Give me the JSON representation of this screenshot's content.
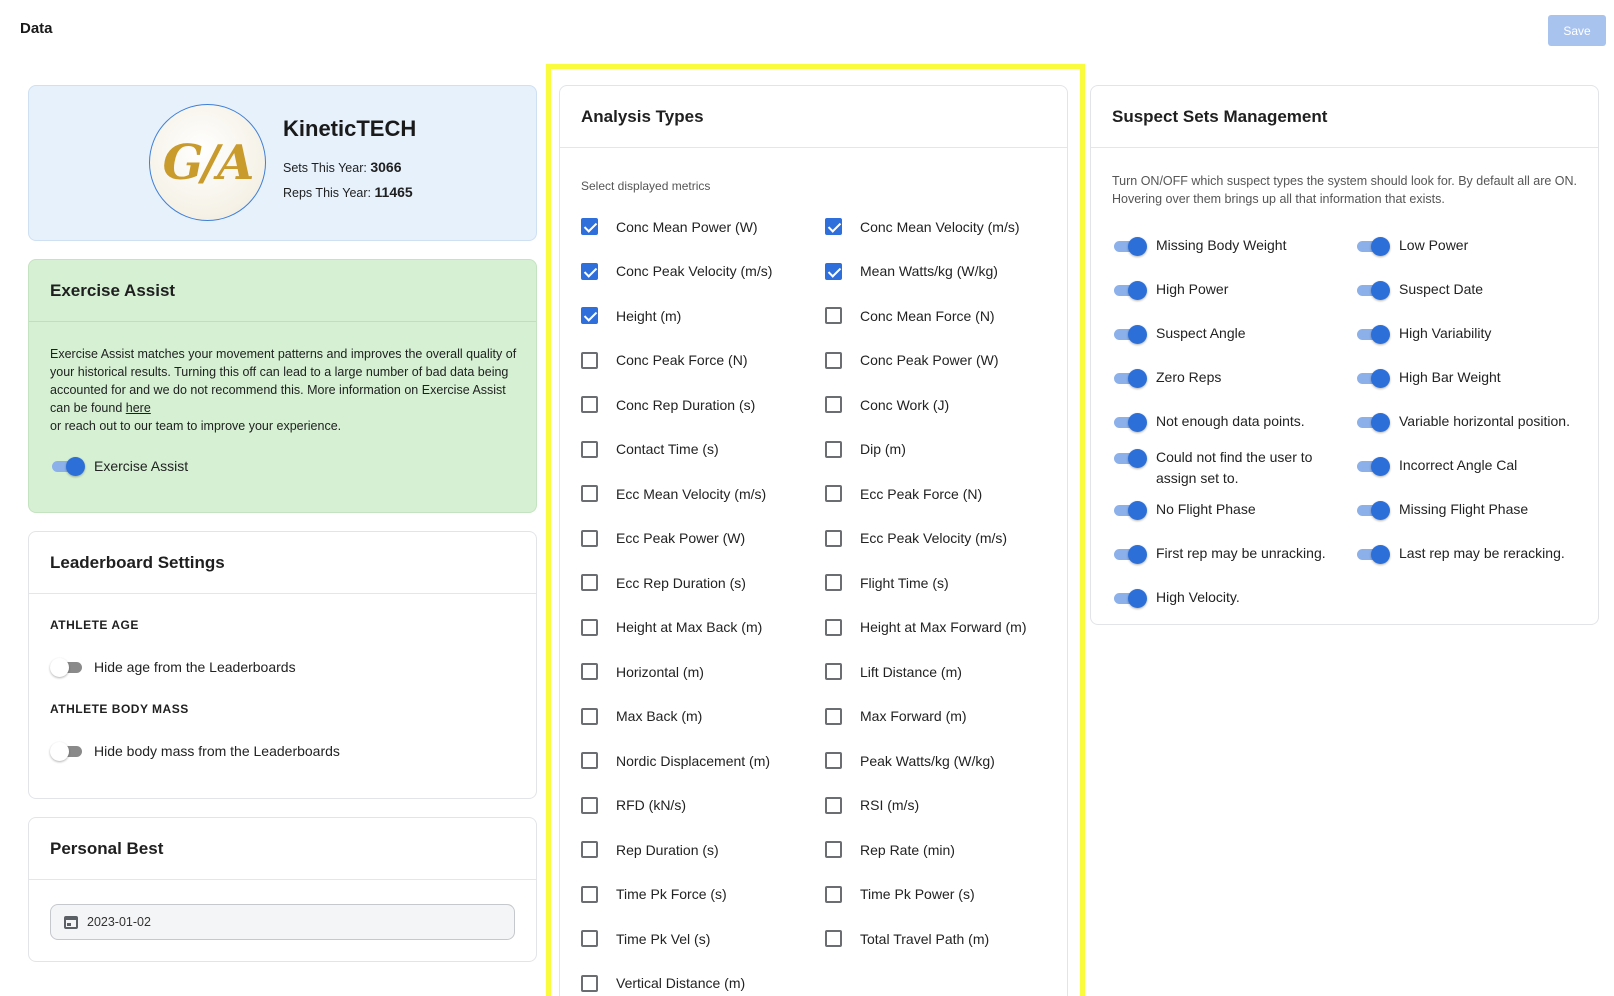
{
  "page": {
    "title": "Data",
    "save_label": "Save"
  },
  "profile": {
    "logo_text": "G/A",
    "name": "KineticTECH",
    "sets_label": "Sets This Year:",
    "sets_value": "3066",
    "reps_label": "Reps This Year:",
    "reps_value": "11465"
  },
  "exercise_assist": {
    "title": "Exercise Assist",
    "description": "Exercise Assist matches your movement patterns and improves the overall quality of your historical results. Turning this off can lead to a large number of bad data being accounted for and we do not recommend this. More information on Exercise Assist can be found ",
    "link_text": "here",
    "description_end": "or reach out to our team to improve your experience.",
    "toggle_label": "Exercise Assist",
    "toggle_on": true
  },
  "leaderboard": {
    "title": "Leaderboard Settings",
    "age_label": "ATHLETE AGE",
    "age_toggle_label": "Hide age from the Leaderboards",
    "mass_label": "ATHLETE BODY MASS",
    "mass_toggle_label": "Hide body mass from the Leaderboards"
  },
  "personal_best": {
    "title": "Personal Best",
    "date_value": "2023-01-02"
  },
  "analysis": {
    "title": "Analysis Types",
    "subtitle": "Select displayed metrics",
    "left": [
      {
        "label": "Conc Mean Power (W)",
        "checked": true
      },
      {
        "label": "Conc Peak Velocity (m/s)",
        "checked": true
      },
      {
        "label": "Height (m)",
        "checked": true
      },
      {
        "label": "Conc Peak Force (N)",
        "checked": false
      },
      {
        "label": "Conc Rep Duration (s)",
        "checked": false
      },
      {
        "label": "Contact Time (s)",
        "checked": false
      },
      {
        "label": "Ecc Mean Velocity (m/s)",
        "checked": false
      },
      {
        "label": "Ecc Peak Power (W)",
        "checked": false
      },
      {
        "label": "Ecc Rep Duration (s)",
        "checked": false
      },
      {
        "label": "Height at Max Back (m)",
        "checked": false
      },
      {
        "label": "Horizontal (m)",
        "checked": false
      },
      {
        "label": "Max Back (m)",
        "checked": false
      },
      {
        "label": "Nordic Displacement (m)",
        "checked": false
      },
      {
        "label": "RFD (kN/s)",
        "checked": false
      },
      {
        "label": "Rep Duration (s)",
        "checked": false
      },
      {
        "label": "Time Pk Force (s)",
        "checked": false
      },
      {
        "label": "Time Pk Vel (s)",
        "checked": false
      },
      {
        "label": "Vertical Distance (m)",
        "checked": false
      }
    ],
    "right": [
      {
        "label": "Conc Mean Velocity (m/s)",
        "checked": true
      },
      {
        "label": "Mean Watts/kg (W/kg)",
        "checked": true
      },
      {
        "label": "Conc Mean Force (N)",
        "checked": false
      },
      {
        "label": "Conc Peak Power (W)",
        "checked": false
      },
      {
        "label": "Conc Work (J)",
        "checked": false
      },
      {
        "label": "Dip (m)",
        "checked": false
      },
      {
        "label": "Ecc Peak Force (N)",
        "checked": false
      },
      {
        "label": "Ecc Peak Velocity (m/s)",
        "checked": false
      },
      {
        "label": "Flight Time (s)",
        "checked": false
      },
      {
        "label": "Height at Max Forward (m)",
        "checked": false
      },
      {
        "label": "Lift Distance (m)",
        "checked": false
      },
      {
        "label": "Max Forward (m)",
        "checked": false
      },
      {
        "label": "Peak Watts/kg (W/kg)",
        "checked": false
      },
      {
        "label": "RSI (m/s)",
        "checked": false
      },
      {
        "label": "Rep Rate (min)",
        "checked": false
      },
      {
        "label": "Time Pk Power (s)",
        "checked": false
      },
      {
        "label": "Total Travel Path (m)",
        "checked": false
      }
    ]
  },
  "suspect": {
    "title": "Suspect Sets Management",
    "description": "Turn ON/OFF which suspect types the system should look for. By default all are ON. Hovering over them brings up all that information that exists.",
    "left": [
      "Missing Body Weight",
      "High Power",
      "Suspect Angle",
      "Zero Reps",
      "Not enough data points.",
      "Could not find the user to assign set to.",
      "No Flight Phase",
      "First rep may be unracking.",
      "High Velocity."
    ],
    "right": [
      "Low Power",
      "Suspect Date",
      "High Variability",
      "High Bar Weight",
      "Variable horizontal position.",
      "Incorrect Angle Cal",
      "Missing Flight Phase",
      "Last rep may be reracking."
    ]
  }
}
